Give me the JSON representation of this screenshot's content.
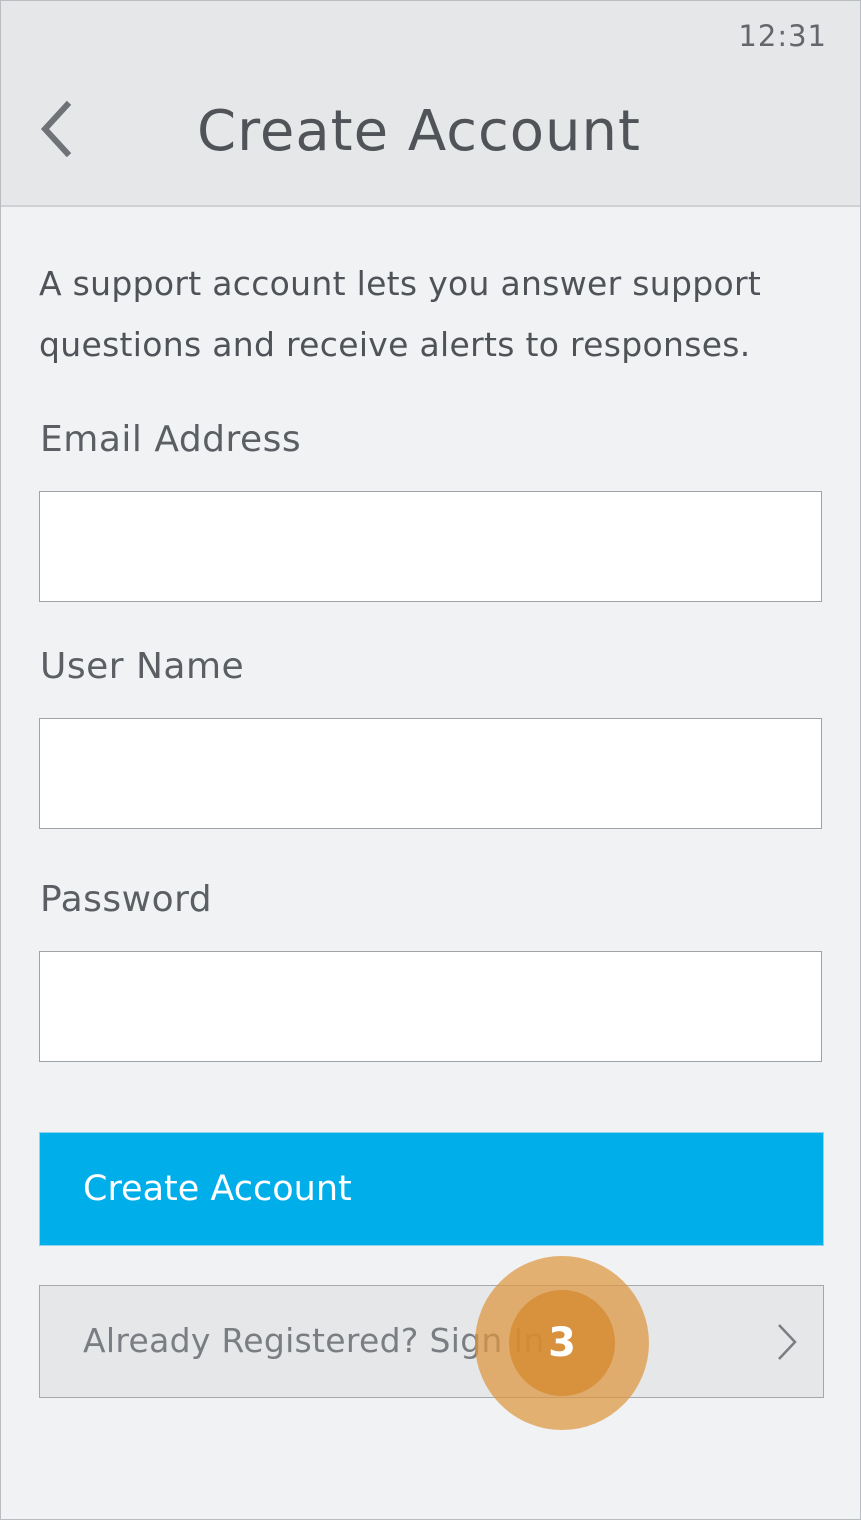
{
  "status_bar": {
    "time": "12:31"
  },
  "header": {
    "title": "Create Account",
    "back_icon": "chevron-left-icon"
  },
  "intro_text": "A support account lets you answer support questions and receive alerts to responses.",
  "form": {
    "email": {
      "label": "Email Address",
      "value": "",
      "placeholder": ""
    },
    "username": {
      "label": "User Name",
      "value": "",
      "placeholder": ""
    },
    "password": {
      "label": "Password",
      "value": "",
      "placeholder": ""
    }
  },
  "create_button": {
    "label": "Create Account"
  },
  "signin_link": {
    "label": "Already Registered? Sign In",
    "icon": "chevron-right-icon"
  },
  "step_marker": {
    "number": "3"
  },
  "colors": {
    "accent": "#00aeea",
    "background": "#f1f2f4",
    "header": "#e6e7e9",
    "marker": "#dd963e"
  }
}
